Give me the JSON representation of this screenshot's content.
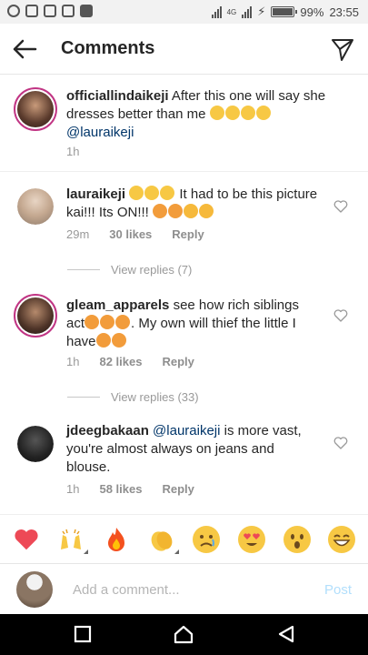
{
  "status_bar": {
    "network": "4G",
    "battery": "99%",
    "time": "23:55"
  },
  "header": {
    "title": "Comments"
  },
  "caption": {
    "username": "officiallindaikeji",
    "text": "After this one will say she dresses better than me",
    "mention": "@lauraikeji",
    "time": "1h"
  },
  "comments": [
    {
      "username": "lauraikeji",
      "text_part1": "It had to be this picture kai!!! Its ON!!!",
      "time": "29m",
      "likes": "30 likes",
      "reply": "Reply",
      "view_replies": "View replies (7)"
    },
    {
      "username": "gleam_apparels",
      "text_part1": "see how rich siblings act",
      "text_part2": ". My own will thief the little I have",
      "time": "1h",
      "likes": "82 likes",
      "reply": "Reply",
      "view_replies": "View replies (33)"
    },
    {
      "username": "jdeegbakaan",
      "mention": "@lauraikeji",
      "text_part1": "is more vast, you're almost always on jeans and blouse.",
      "time": "1h",
      "likes": "58 likes",
      "reply": "Reply"
    }
  ],
  "emoji_bar": [
    "heart-icon",
    "raised-hands-emoji",
    "fire-emoji",
    "clapping-hands-emoji",
    "sad-face-emoji",
    "heart-eyes-emoji",
    "surprised-face-emoji",
    "grinning-face-emoji"
  ],
  "input": {
    "placeholder": "Add a comment...",
    "post_label": "Post"
  },
  "colors": {
    "accent_link": "#003569",
    "post_disabled": "#b2dffc",
    "heart": "#ed4956"
  }
}
